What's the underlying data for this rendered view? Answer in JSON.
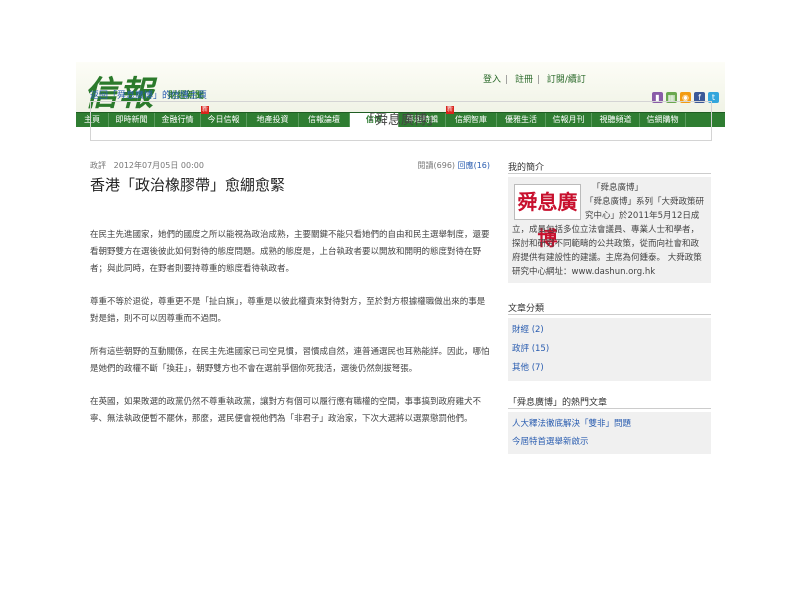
{
  "header": {
    "logo": "信報",
    "logo_sub": "財經新聞",
    "top_links": [
      "登入",
      "註冊",
      "訂閱/續訂"
    ],
    "social_icons": [
      "mobile-icon",
      "calendar-icon",
      "rss-icon",
      "facebook-icon",
      "twitter-icon"
    ]
  },
  "nav": [
    {
      "label": "主頁"
    },
    {
      "label": "即時新聞"
    },
    {
      "label": "金融行情"
    },
    {
      "label": "今日信報",
      "badge": "新"
    },
    {
      "label": "地產投資"
    },
    {
      "label": "信報論壇"
    },
    {
      "label": "信博",
      "active": true
    },
    {
      "label": "專題特輯"
    },
    {
      "label": "信網智庫",
      "badge": "新"
    },
    {
      "label": "優雅生活"
    },
    {
      "label": "信報月刊"
    },
    {
      "label": "視聽頻道"
    },
    {
      "label": "信網購物"
    }
  ],
  "breadcrumb": "返回「舜息廣博」的信博主頁",
  "blog_title": "「舜息廣博」",
  "article": {
    "category": "政評",
    "date": "2012年07月05日 00:00",
    "views": "閱讀(696)",
    "replies": "回應(16)",
    "headline": "香港「政治橡膠帶」愈綳愈緊",
    "paragraphs": [
      "在民主先進國家，她們的國度之所以能視為政治成熟，主要關鍵不能只看她們的自由和民主選舉制度，還要看朝野雙方在選後彼此如何對待的態度問題。成熟的態度是，上台執政者要以開放和開明的態度對待在野者；與此同時，在野者則要持尊重的態度看待執政者。",
      "尊重不等於退從，尊重更不是「扯白旗」，尊重是以彼此權責來對待對方，至於對方根據權職做出來的事是對是錯，則不可以因尊重而不過問。",
      "所有這些朝野的互動關係，在民主先進國家已司空見慣，習慣成自然，連普通選民也耳熟能詳。因此，哪怕是她們的政權不斷「換莊」，朝野雙方也不會在選前爭個你死我活，選後仍然劍拔弩張。",
      "在英國，如果敗選的政黨仍然不尊重執政黨，讓對方有個可以履行應有職權的空間，事事搞到政府雞犬不寧、無法執政便暫不罷休，那麼，選民便會視他們為「非君子」政治家，下次大選將以選票懲罰他們。"
    ]
  },
  "sidebar": {
    "profile_heading": "我的簡介",
    "profile_logo": "舜息廣博",
    "profile_name": "「舜息廣博」",
    "profile_text": "「舜息廣博」系列「大舜政策研究中心」於2011年5月12日成立，成員包括多位立法會議員、專業人士和學者，探討和研究不同範疇的公共政策，從而向社會和政府提供有建設性的建議。主席為何鍾泰。 大舜政策研究中心網址：www.dashun.org.hk",
    "categories_heading": "文章分類",
    "categories": [
      "財經 (2)",
      "政評 (15)",
      "其他 (7)"
    ],
    "hot_heading": "「舜息廣博」的熱門文章",
    "hot_articles": [
      "人大釋法徹底解決「雙非」問題",
      "今屆特首選舉新啟示"
    ]
  },
  "colors": {
    "brand_green": "#2f7d32",
    "link_blue": "#2a5db0",
    "badge_red": "#d9241c"
  }
}
